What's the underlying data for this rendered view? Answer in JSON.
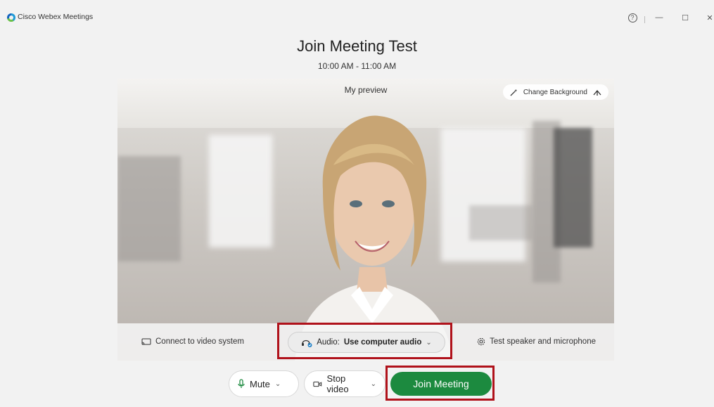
{
  "window": {
    "app_title": "Cisco Webex Meetings",
    "help_label": "?",
    "minimize_label": "—",
    "maximize_label": "☐",
    "close_label": "✕"
  },
  "meeting": {
    "title": "Join Meeting Test",
    "time": "10:00 AM - 11:00 AM"
  },
  "preview": {
    "label": "My preview",
    "change_background": "Change Background",
    "connect_video": "Connect to video system",
    "audio_prefix": "Audio:",
    "audio_value": "Use computer audio",
    "test_speaker": "Test speaker and microphone"
  },
  "controls": {
    "mute_label": "Mute",
    "stop_video_label": "Stop video",
    "join_label": "Join Meeting"
  },
  "colors": {
    "join_green": "#1c8a3f",
    "highlight_red": "#b0121b"
  }
}
